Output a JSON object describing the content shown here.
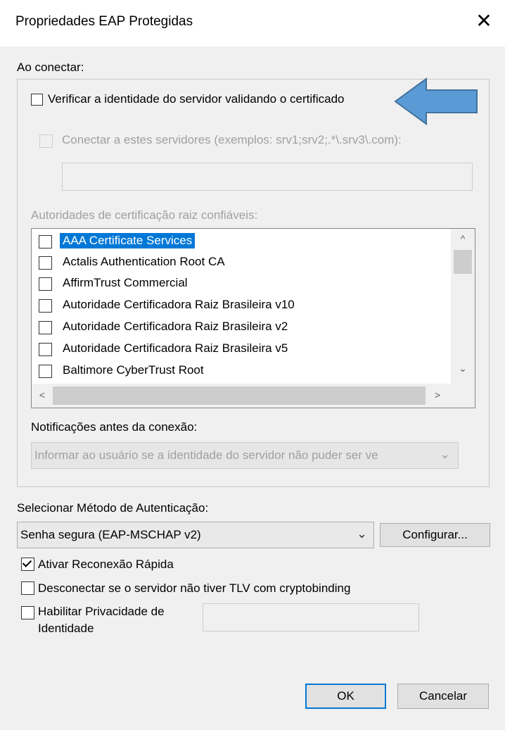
{
  "window": {
    "title": "Propriedades EAP Protegidas",
    "close_glyph": "✕"
  },
  "connect_section": {
    "heading": "Ao conectar:",
    "verify_server": {
      "label": "Verificar a identidade do servidor validando o certificado",
      "checked": false
    },
    "connect_servers": {
      "label": "Conectar a estes servidores (exemplos: srv1;srv2;.*\\.srv3\\.com):",
      "checked": false,
      "enabled": false
    },
    "servers_value": "",
    "trusted_roots_label": "Autoridades de certificação raiz confiáveis:",
    "trusted_roots": [
      {
        "label": "AAA Certificate Services",
        "checked": false,
        "selected": true
      },
      {
        "label": "Actalis Authentication Root CA",
        "checked": false,
        "selected": false
      },
      {
        "label": "AffirmTrust Commercial",
        "checked": false,
        "selected": false
      },
      {
        "label": "Autoridade Certificadora Raiz Brasileira v10",
        "checked": false,
        "selected": false
      },
      {
        "label": "Autoridade Certificadora Raiz Brasileira v2",
        "checked": false,
        "selected": false
      },
      {
        "label": "Autoridade Certificadora Raiz Brasileira v5",
        "checked": false,
        "selected": false
      },
      {
        "label": "Baltimore CyberTrust Root",
        "checked": false,
        "selected": false
      }
    ],
    "scroll": {
      "up": "^",
      "down": "⌄",
      "left": "<",
      "right": ">"
    },
    "notifications_label": "Notificações antes da conexão:",
    "notifications_value": "Informar ao usuário se a identidade do servidor não puder ser ve",
    "notifications_chevron": "⌄"
  },
  "auth": {
    "method_label": "Selecionar Método de Autenticação:",
    "method_value": "Senha segura (EAP-MSCHAP v2)",
    "method_chevron": "⌄",
    "configure_label": "Configurar..."
  },
  "options": {
    "fast_reconnect": {
      "label": "Ativar Reconexão Rápida",
      "checked": true
    },
    "disconnect_tlv": {
      "label": "Desconectar se o servidor não tiver TLV com cryptobinding",
      "checked": false
    },
    "identity_privacy": {
      "label_line1": "Habilitar Privacidade de",
      "label_line2": "Identidade",
      "checked": false,
      "value": ""
    }
  },
  "buttons": {
    "ok": "OK",
    "cancel": "Cancelar"
  },
  "colors": {
    "selection": "#0078d7",
    "callout_arrow": "#5b9bd5"
  }
}
